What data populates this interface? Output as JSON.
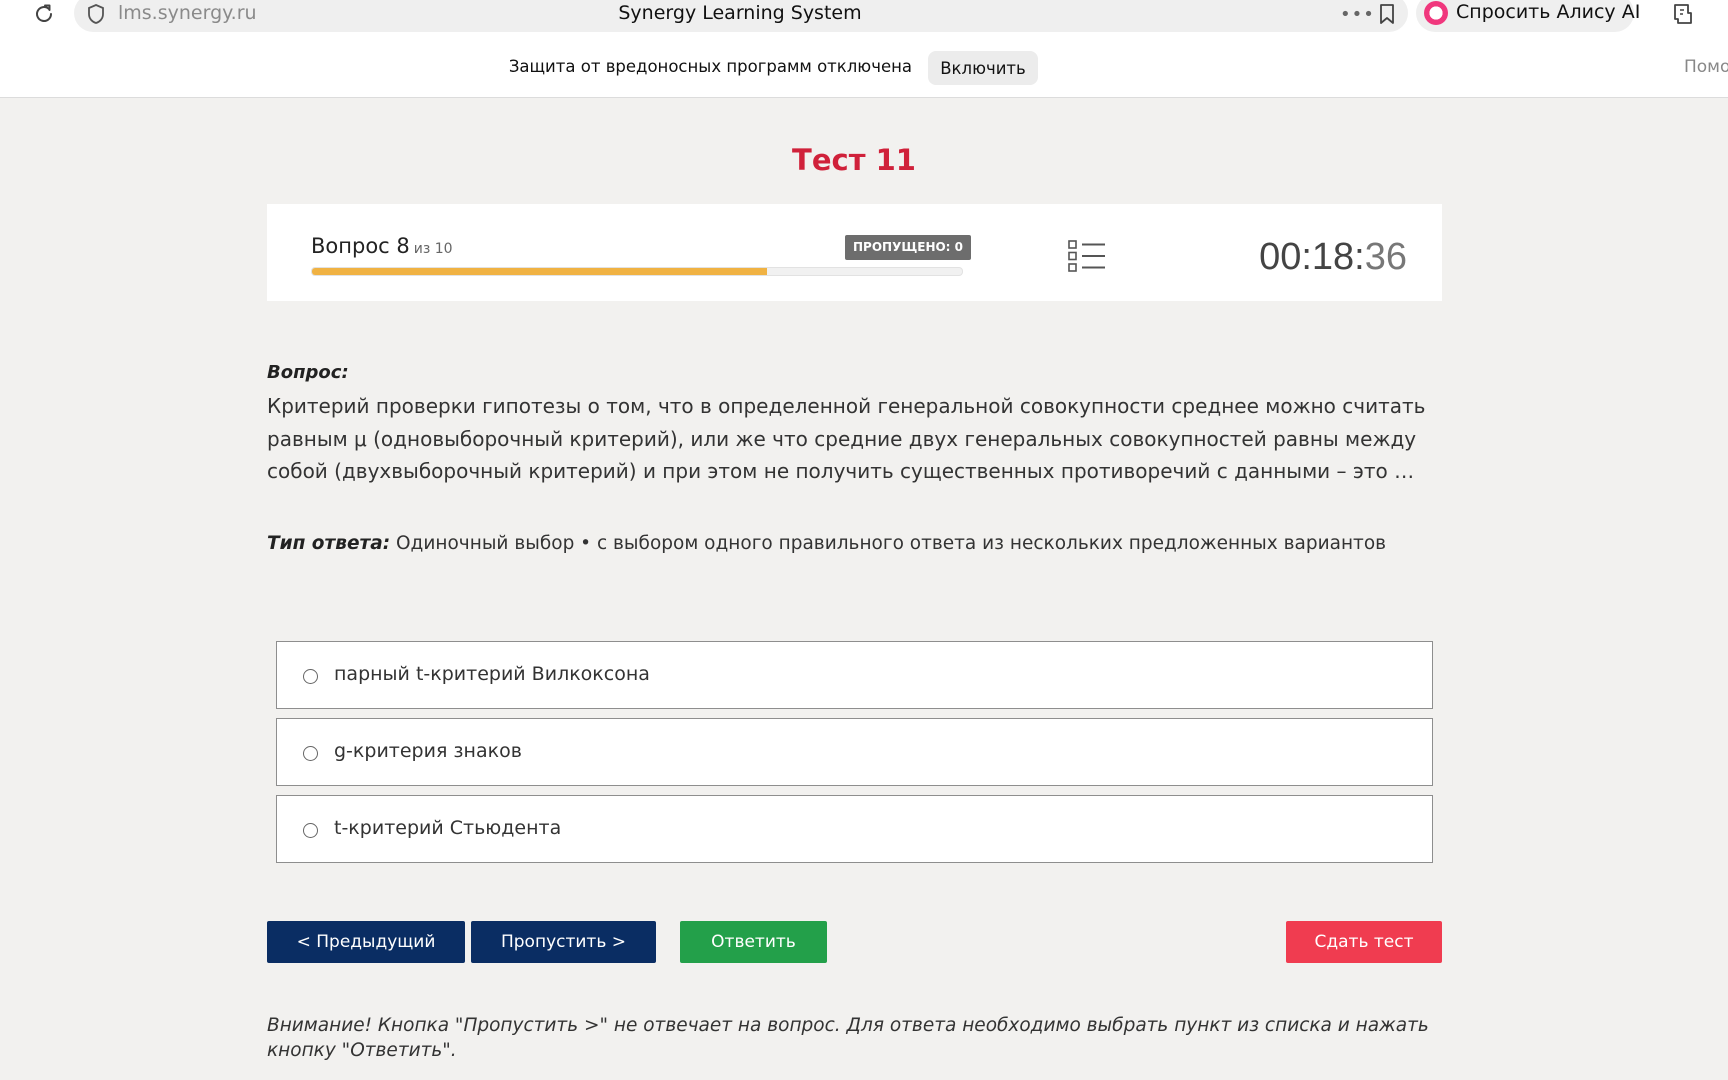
{
  "browser": {
    "url": "lms.synergy.ru",
    "window_title": "Synergy Learning System",
    "alice_button": "Спросить Алису AI",
    "protection_message": "Защита от вредоносных программ отключена",
    "enable_button": "Включить",
    "help_link": "Помо"
  },
  "test": {
    "title": "Тест 11",
    "question_label": "Вопрос 8",
    "question_of": "из 10",
    "skipped_label": "ПРОПУЩЕНО: 0",
    "progress_fraction": 0.7,
    "timer_main": "00:18:",
    "timer_seconds": "36"
  },
  "question": {
    "heading": "Вопрос:",
    "text": "Критерий проверки гипотезы о том, что в определенной генеральной совокупности среднее можно считать равным μ (одновыборочный критерий), или же что средние двух генеральных совокупностей равны между собой (двухвыборочный критерий) и при этом не получить существенных противоречий с данными – это …",
    "answer_type_label": "Тип ответа:",
    "answer_type_value": "Одиночный выбор • с выбором одного правильного ответа из нескольких предложенных вариантов"
  },
  "options": [
    "парный t-критерий Вилкоксона",
    "g-критерия знаков",
    "t-критерий Стьюдента"
  ],
  "buttons": {
    "prev": "< Предыдущий",
    "skip": "Пропустить >",
    "answer": "Ответить",
    "submit": "Сдать тест"
  },
  "warning": "Внимание! Кнопка \"Пропустить >\" не отвечает на вопрос. Для ответа необходимо выбрать пункт из списка и нажать кнопку \"Ответить\".",
  "colors": {
    "title_red": "#d0213a",
    "progress": "#f0b243",
    "nav_blue": "#0a2d63",
    "answer_green": "#23a04a",
    "submit_red": "#f03c50"
  }
}
